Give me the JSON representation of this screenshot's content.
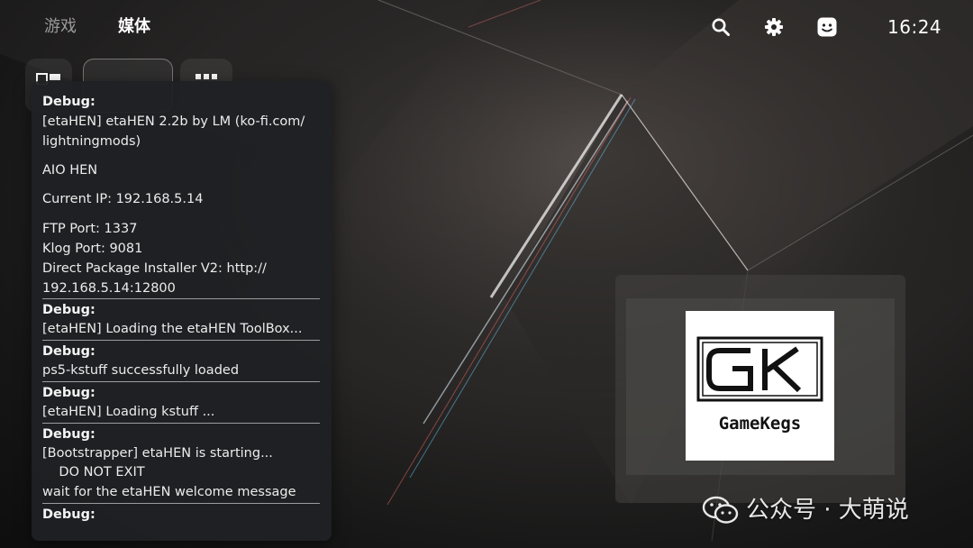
{
  "nav": {
    "tabs": [
      "游戏",
      "媒体"
    ],
    "active_tab": "媒体"
  },
  "status": {
    "time": "16:24"
  },
  "icons": {
    "search": "search-icon",
    "settings": "gear-icon",
    "profile": "avatar-icon",
    "shortcuts": [
      "library-icon",
      "grid-icon"
    ]
  },
  "debug_panel": {
    "messages": [
      {
        "title": "Debug:",
        "lines": [
          "[etaHEN] etaHEN 2.2b by LM (ko-fi.com/",
          "lightningmods)",
          "AIO HEN",
          "Current IP: 192.168.5.14",
          "FTP Port: 1337",
          "Klog Port: 9081",
          "Direct Package Installer V2: http://",
          "192.168.5.14:12800"
        ]
      },
      {
        "title": "Debug:",
        "lines": [
          "[etaHEN] Loading the etaHEN ToolBox..."
        ]
      },
      {
        "title": "Debug:",
        "lines": [
          "ps5-kstuff successfully loaded"
        ]
      },
      {
        "title": "Debug:",
        "lines": [
          "[etaHEN] Loading kstuff ..."
        ]
      },
      {
        "title": "Debug:",
        "lines": [
          "[Bootstrapper] etaHEN is starting...",
          "    DO NOT EXIT",
          "wait for the etaHEN welcome message"
        ]
      },
      {
        "title": "Debug:",
        "lines": []
      }
    ]
  },
  "game_tile": {
    "logo_letters": "GK",
    "logo_name": "GameKegs"
  },
  "watermark": {
    "text": "公众号 · 大萌说",
    "icon": "wechat-icon"
  },
  "colors": {
    "panel_bg": "#1f2124",
    "separator": "#9c9c9c",
    "active_tab": "#ffffff",
    "inactive_tab": "#9a9a9a"
  }
}
